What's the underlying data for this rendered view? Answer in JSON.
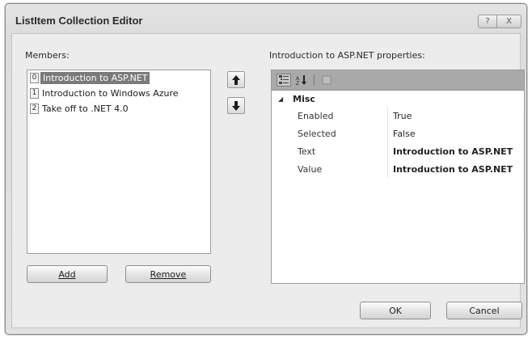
{
  "window": {
    "title": "ListItem Collection Editor",
    "help_glyph": "?",
    "close_glyph": "X"
  },
  "members": {
    "label": "Members:",
    "items": [
      {
        "index": "0",
        "text": "Introduction to ASP.NET",
        "selected": true
      },
      {
        "index": "1",
        "text": "Introduction to Windows Azure",
        "selected": false
      },
      {
        "index": "2",
        "text": "Take off to .NET 4.0",
        "selected": false
      }
    ],
    "add_label": "Add",
    "remove_label": "Remove"
  },
  "properties": {
    "label": "Introduction to ASP.NET properties:",
    "category": "Misc",
    "rows": [
      {
        "name": "Enabled",
        "value": "True",
        "bold": false
      },
      {
        "name": "Selected",
        "value": "False",
        "bold": false
      },
      {
        "name": "Text",
        "value": "Introduction to ASP.NET",
        "bold": true
      },
      {
        "name": "Value",
        "value": "Introduction to ASP.NET",
        "bold": true
      }
    ]
  },
  "footer": {
    "ok_label": "OK",
    "cancel_label": "Cancel"
  },
  "icons": {
    "move_up": "arrow-up-icon",
    "move_down": "arrow-down-icon",
    "categorized": "categorized-icon",
    "alphabetical": "alphabetical-sort-icon",
    "property_pages": "property-pages-icon"
  }
}
